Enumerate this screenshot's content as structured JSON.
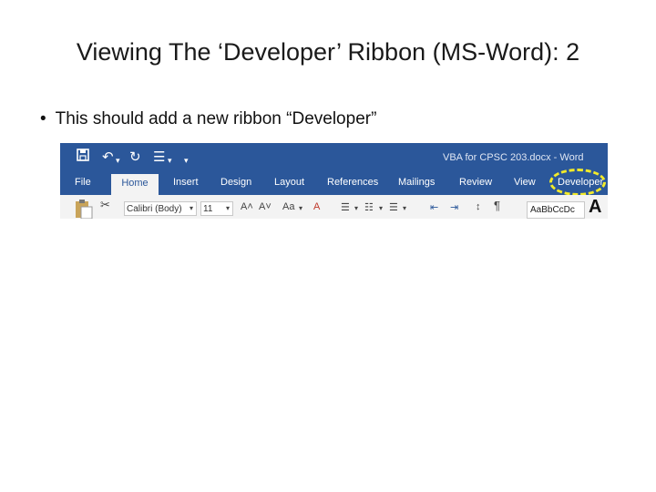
{
  "slide": {
    "title": "Viewing The ‘Developer’ Ribbon (MS-Word): 2",
    "bullet": "This should add a new ribbon “Developer”"
  },
  "word_window": {
    "quick_access": {
      "save_icon": "save-icon",
      "undo_icon": "undo-icon",
      "redo_icon": "redo-icon",
      "list_icon": "list-icon",
      "customize_icon": "customize-icon"
    },
    "doc_title": "VBA for CPSC 203.docx - Word",
    "colors": {
      "titlebar": "#2b579a",
      "ribbon": "#f3f3f3",
      "highlight": "#f2ea2a"
    },
    "tabs": {
      "file": "File",
      "home": "Home",
      "insert": "Insert",
      "design": "Design",
      "layout": "Layout",
      "references": "References",
      "mailings": "Mailings",
      "review": "Review",
      "view": "View",
      "developer": "Developer"
    },
    "ribbon": {
      "font_name": "Calibri (Body)",
      "font_size": "11",
      "style_preview": "AaBbCcDc",
      "style_big": "A",
      "grow_font": "A˄",
      "shrink_font": "A˅",
      "case": "Aa",
      "clear_format": "A",
      "bullets": "☰",
      "pilcrow": "¶"
    }
  }
}
